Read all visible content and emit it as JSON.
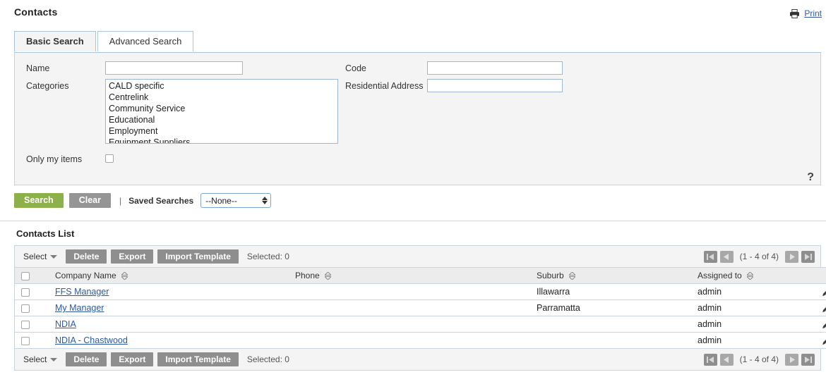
{
  "header": {
    "title": "Contacts",
    "print_label": "Print",
    "printer_icon": "printer-icon"
  },
  "tabs": [
    {
      "label": "Basic Search",
      "active": true
    },
    {
      "label": "Advanced Search",
      "active": false
    }
  ],
  "search_form": {
    "name_label": "Name",
    "name_value": "",
    "categories_label": "Categories",
    "categories_options": [
      "CALD specific",
      "Centrelink",
      "Community Service",
      "Educational",
      "Employment",
      "Equipment Suppliers"
    ],
    "code_label": "Code",
    "code_value": "",
    "residential_label": "Residential Address",
    "residential_value": "",
    "only_my_items_label": "Only my items",
    "only_my_items_checked": false,
    "help_glyph": "?"
  },
  "actions": {
    "search_label": "Search",
    "clear_label": "Clear",
    "divider": "|",
    "saved_searches_label": "Saved Searches",
    "saved_searches_value": "--None--",
    "saved_searches_options": [
      "--None--"
    ]
  },
  "list": {
    "title": "Contacts List",
    "toolbar": {
      "select_label": "Select",
      "delete_label": "Delete",
      "export_label": "Export",
      "import_label": "Import Template",
      "selected_label": "Selected: 0"
    },
    "pager": {
      "range_label": "(1 - 4 of 4)",
      "first_icon": "first-page-icon",
      "prev_icon": "previous-page-icon",
      "next_icon": "next-page-icon",
      "last_icon": "last-page-icon"
    },
    "columns": [
      {
        "key": "company",
        "label": "Company Name"
      },
      {
        "key": "phone",
        "label": "Phone"
      },
      {
        "key": "suburb",
        "label": "Suburb"
      },
      {
        "key": "assigned",
        "label": "Assigned to"
      }
    ],
    "rows": [
      {
        "company": "FFS Manager",
        "phone": "",
        "suburb": "Illawarra",
        "assigned": "admin"
      },
      {
        "company": "My Manager",
        "phone": "",
        "suburb": "Parramatta",
        "assigned": "admin"
      },
      {
        "company": "NDIA",
        "phone": "",
        "suburb": "",
        "assigned": "admin"
      },
      {
        "company": "NDIA - Chastwood",
        "phone": "",
        "suburb": "",
        "assigned": "admin"
      }
    ]
  },
  "colors": {
    "search_button": "#8cb14a",
    "gray_button": "#8e8e8e",
    "link": "#2c5aa0",
    "panel_bg": "#f4f4f4",
    "header_bg": "#ececec",
    "border": "#c8d4e0"
  }
}
